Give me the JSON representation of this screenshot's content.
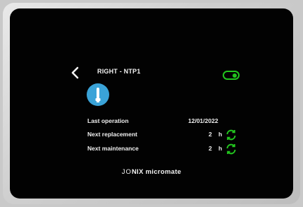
{
  "header": {
    "title": "RIGHT - NTP1",
    "back_icon": "chevron-left-icon",
    "toggle_state": "on"
  },
  "device_icon": "lamp-bulb-icon",
  "info": {
    "last_operation_label": "Last operation",
    "last_operation_value": "12/01/2022",
    "next_replacement_label": "Next replacement",
    "next_replacement_value": "2",
    "next_replacement_unit": "h",
    "next_maintenance_label": "Next maintenance",
    "next_maintenance_value": "2",
    "next_maintenance_unit": "h"
  },
  "brand": {
    "prefix": "JO",
    "rest": "NIX micromate"
  },
  "colors": {
    "accent_green": "#22c51e",
    "icon_blue": "#3aa3d8",
    "screen_bg": "#020202"
  }
}
